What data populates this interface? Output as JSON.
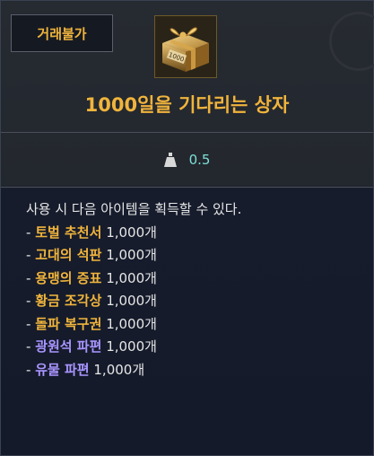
{
  "header": {
    "trade_badge": "거래불가",
    "item_title": "1000일을 기다리는 상자",
    "icon_label": "1000"
  },
  "stats": {
    "weight_icon": "weight-icon",
    "weight_value": "0.5"
  },
  "description": {
    "intro": "사용 시 다음 아이템을 획득할 수 있다.",
    "items": [
      {
        "prefix": "- ",
        "name": "토벌 추천서",
        "qty": " 1,000개",
        "color": "#f0b43c"
      },
      {
        "prefix": "- ",
        "name": "고대의 석판",
        "qty": " 1,000개",
        "color": "#f0b43c"
      },
      {
        "prefix": "- ",
        "name": "용맹의 증표",
        "qty": " 1,000개",
        "color": "#f0b43c"
      },
      {
        "prefix": "- ",
        "name": "황금 조각상",
        "qty": " 1,000개",
        "color": "#f0b43c"
      },
      {
        "prefix": "- ",
        "name": "돌파 복구권",
        "qty": " 1,000개",
        "color": "#f0b43c"
      },
      {
        "prefix": "- ",
        "name": "광원석 파편",
        "qty": " 1,000개",
        "color": "#a995ff"
      },
      {
        "prefix": "- ",
        "name": "유물 파편",
        "qty": " 1,000개",
        "color": "#a995ff"
      }
    ]
  },
  "colors": {
    "gold": "#f0b43c",
    "purple": "#a995ff",
    "teal": "#7ee0d8"
  }
}
